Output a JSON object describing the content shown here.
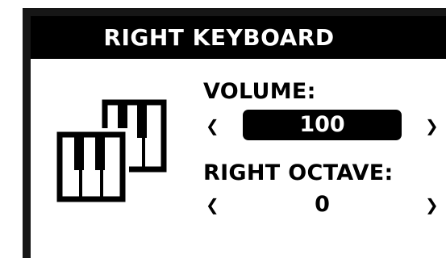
{
  "header": {
    "title": "RIGHT KEYBOARD"
  },
  "volume": {
    "label": "VOLUME:",
    "value": "100",
    "left_arrow": "❮",
    "right_arrow": "❯"
  },
  "octave": {
    "label": "RIGHT OCTAVE:",
    "value": "0",
    "left_arrow": "❮",
    "right_arrow": "❯"
  },
  "icons": {
    "keyboard": "piano-keys-icon"
  },
  "colors": {
    "foreground": "#000000",
    "background": "#ffffff",
    "frame": "#161616"
  }
}
